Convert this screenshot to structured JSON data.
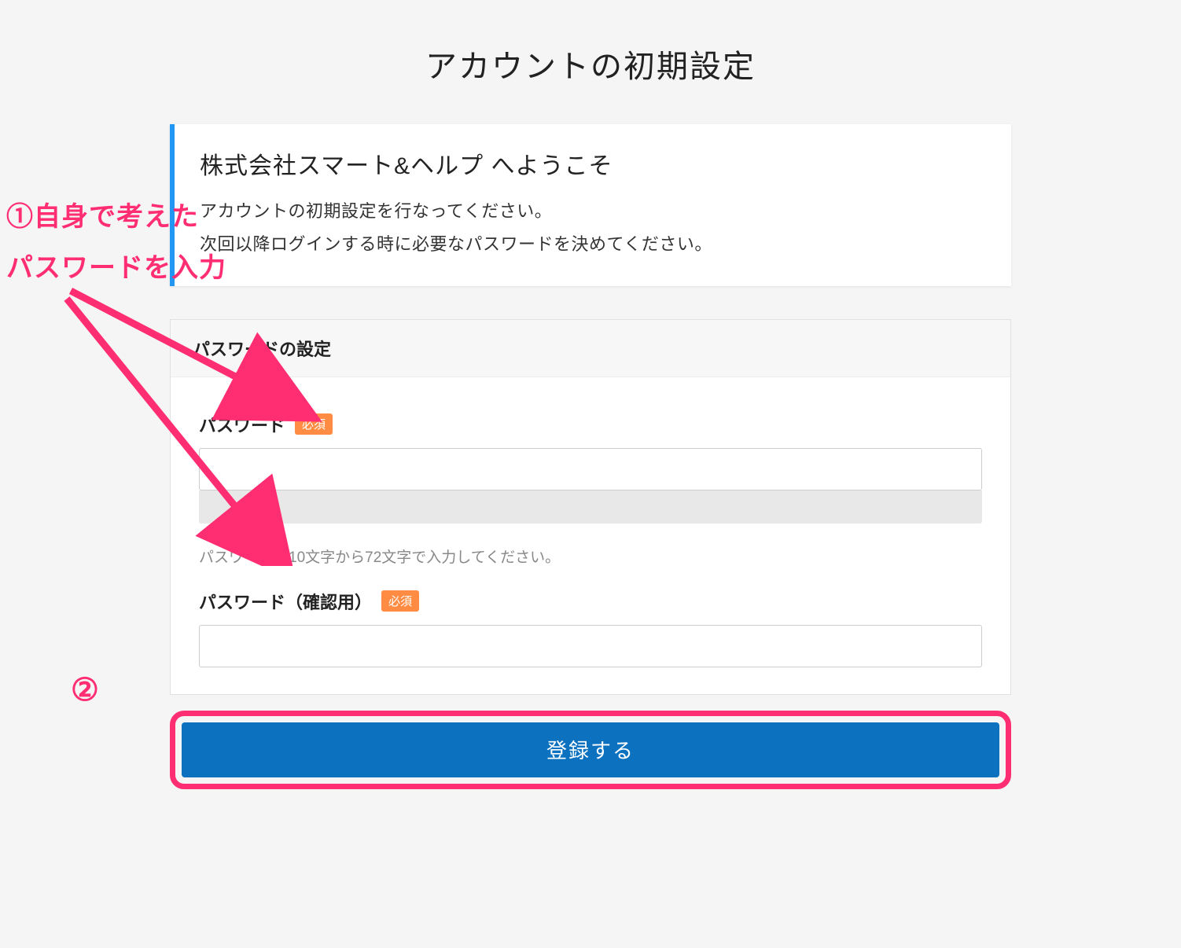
{
  "page": {
    "title": "アカウントの初期設定"
  },
  "welcome": {
    "title": "株式会社スマート&ヘルプ へようこそ",
    "line1": "アカウントの初期設定を行なってください。",
    "line2": "次回以降ログインする時に必要なパスワードを決めてください。"
  },
  "form": {
    "section_title": "パスワードの設定",
    "password_label": "パスワード",
    "password_value": "",
    "required_badge": "必須",
    "helper_text": "パスワードは10文字から72文字で入力してください。",
    "confirm_label": "パスワード（確認用）",
    "confirm_value": "",
    "submit_label": "登録する"
  },
  "annotations": {
    "step1_line1": "①自身で考えた",
    "step1_line2": "パスワードを入力",
    "step2": "②"
  },
  "colors": {
    "accent_blue": "#2196f3",
    "button_blue": "#0c72c0",
    "required_orange": "#ff8c42",
    "annotation_pink": "#ff2d72"
  }
}
